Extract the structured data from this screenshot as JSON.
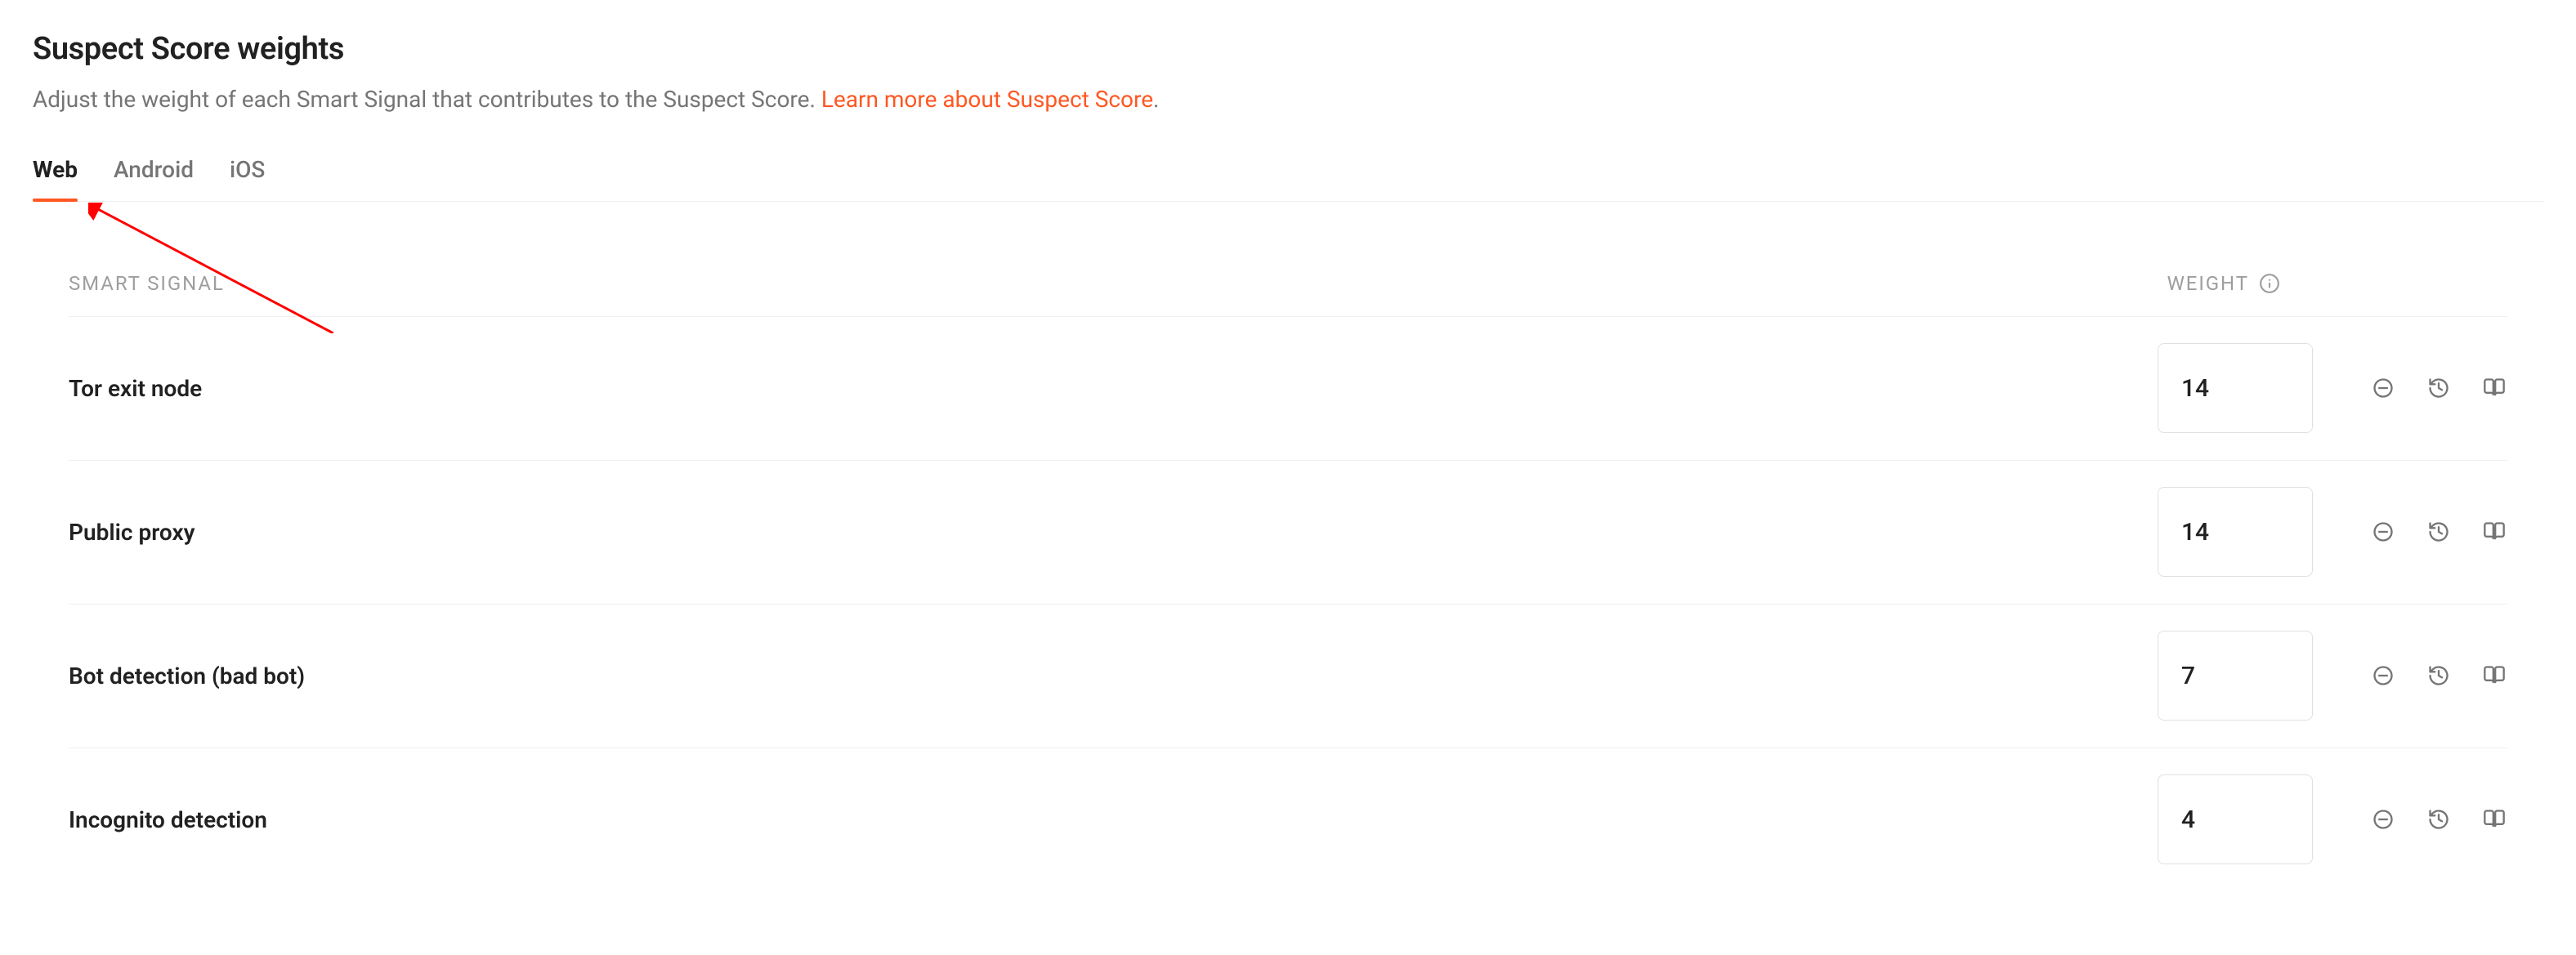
{
  "header": {
    "title": "Suspect Score weights",
    "subtitle_prefix": "Adjust the weight of each Smart Signal that contributes to the Suspect Score. ",
    "subtitle_link": "Learn more about Suspect Score",
    "subtitle_suffix": "."
  },
  "tabs": {
    "web": "Web",
    "android": "Android",
    "ios": "iOS",
    "active": "web"
  },
  "panel": {
    "col_signal": "Smart Signal",
    "col_weight": "Weight"
  },
  "signals": [
    {
      "label": "Tor exit node",
      "weight": "14"
    },
    {
      "label": "Public proxy",
      "weight": "14"
    },
    {
      "label": "Bot detection (bad bot)",
      "weight": "7"
    },
    {
      "label": "Incognito detection",
      "weight": "4"
    }
  ],
  "icons": {
    "info": "info-icon",
    "disable": "disable-icon",
    "history": "history-icon",
    "docs": "docs-icon"
  },
  "colors": {
    "accent": "#FF5722",
    "muted": "#757575",
    "border": "#e0e0e0"
  }
}
